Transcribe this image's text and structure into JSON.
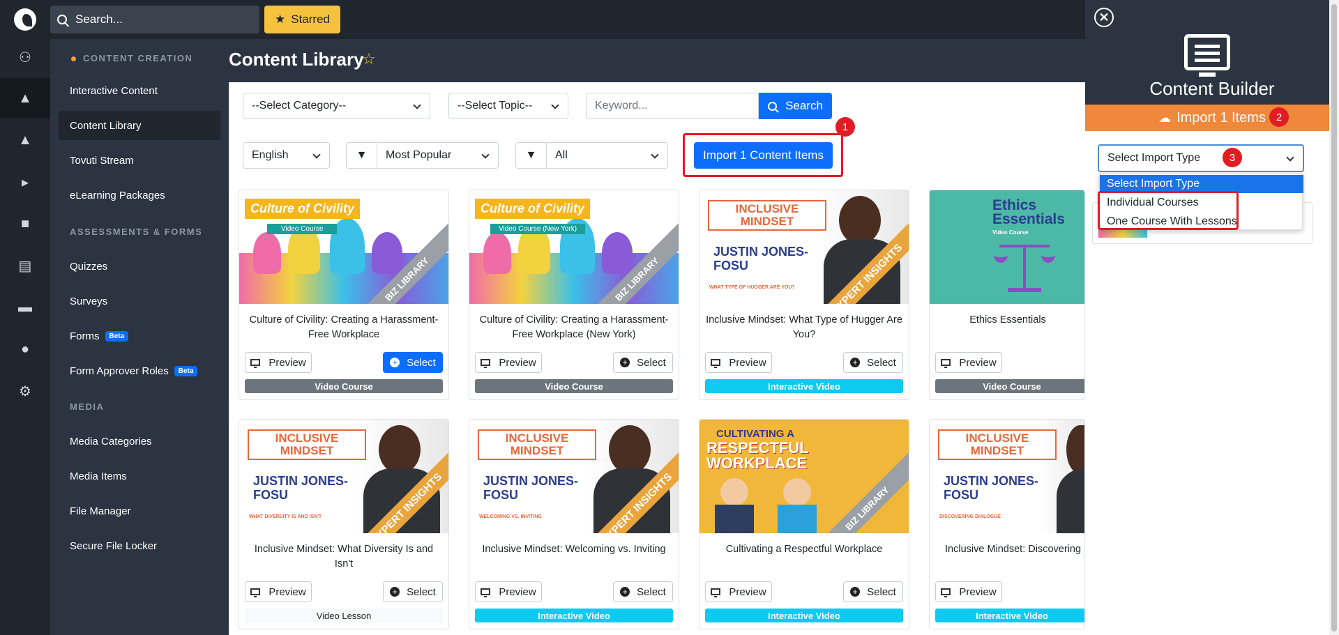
{
  "topbar": {
    "search_placeholder": "Search...",
    "starred_label": "Starred"
  },
  "sidebar": {
    "section_content": "CONTENT CREATION",
    "section_assess": "ASSESSMENTS & FORMS",
    "section_media": "MEDIA",
    "beta_label": "Beta",
    "items": [
      "Interactive Content",
      "Content Library",
      "Tovuti Stream",
      "eLearning Packages",
      "Quizzes",
      "Surveys",
      "Forms",
      "Form Approver Roles",
      "Media Categories",
      "Media Items",
      "File Manager",
      "Secure File Locker"
    ]
  },
  "page": {
    "title": "Content Library"
  },
  "filters": {
    "category": "--Select Category--",
    "topic": "--Select Topic--",
    "keyword_placeholder": "Keyword...",
    "search_label": "Search",
    "language": "English",
    "sort": "Most Popular",
    "type": "All",
    "import_label": "Import 1 Content Items"
  },
  "annotations": [
    "1",
    "2",
    "3"
  ],
  "cards": [
    {
      "thumb_title": "Culture of Civility",
      "thumb_sub": "Video Course",
      "corner": "BIZ LIBRARY",
      "title": "Culture of Civility: Creating a Harassment-Free Workplace",
      "preview": "Preview",
      "select": "Select",
      "type": "Video Course"
    },
    {
      "thumb_title": "Culture of Civility",
      "thumb_sub": "Video Course (New York)",
      "corner": "BIZ LIBRARY",
      "title": "Culture of Civility: Creating a Harassment-Free Workplace (New York)",
      "preview": "Preview",
      "select": "Select",
      "type": "Video Course"
    },
    {
      "thumb_title": "INCLUSIVE MINDSET",
      "thumb_name": "JUSTIN JONES-FOSU",
      "thumb_sub": "WHAT TYPE OF HUGGER ARE YOU?",
      "corner": "EXPERT INSIGHTS",
      "title": "Inclusive Mindset: What Type of Hugger Are You?",
      "preview": "Preview",
      "select": "Select",
      "type": "Interactive Video"
    },
    {
      "thumb_title": "Ethics Essentials",
      "thumb_sub": "Video Course",
      "title": "Ethics Essentials",
      "preview": "Preview",
      "type": "Video Course"
    },
    {
      "thumb_title": "INCLUSIVE MINDSET",
      "thumb_name": "JUSTIN JONES-FOSU",
      "thumb_sub": "WHAT DIVERSITY IS AND ISN'T",
      "corner": "EXPERT INSIGHTS",
      "title": "Inclusive Mindset: What Diversity Is and Isn't",
      "preview": "Preview",
      "select": "Select",
      "type": "Video Lesson"
    },
    {
      "thumb_title": "INCLUSIVE MINDSET",
      "thumb_name": "JUSTIN JONES-FOSU",
      "thumb_sub": "WELCOMING VS. INVITING",
      "corner": "EXPERT INSIGHTS",
      "title": "Inclusive Mindset: Welcoming vs. Inviting",
      "preview": "Preview",
      "select": "Select",
      "type": "Interactive Video"
    },
    {
      "thumb_title": "CULTIVATING A",
      "thumb_name": "RESPECTFUL WORKPLACE",
      "corner": "BIZ LIBRARY",
      "title": "Cultivating a Respectful Workplace",
      "preview": "Preview",
      "select": "Select",
      "type": "Interactive Video"
    },
    {
      "thumb_title": "INCLUSIVE MINDSET",
      "thumb_name": "JUSTIN JONES-FOSU",
      "thumb_sub": "DISCOVERING DIALOGUE",
      "title": "Inclusive Mindset: Discovering",
      "preview": "Preview",
      "type": "Interactive Video"
    }
  ],
  "panel": {
    "title": "Content Builder",
    "import_bar": "Import 1 Items",
    "select_value": "Select Import Type",
    "options": [
      "Select Import Type",
      "Individual Courses",
      "One Course With Lessons"
    ]
  }
}
